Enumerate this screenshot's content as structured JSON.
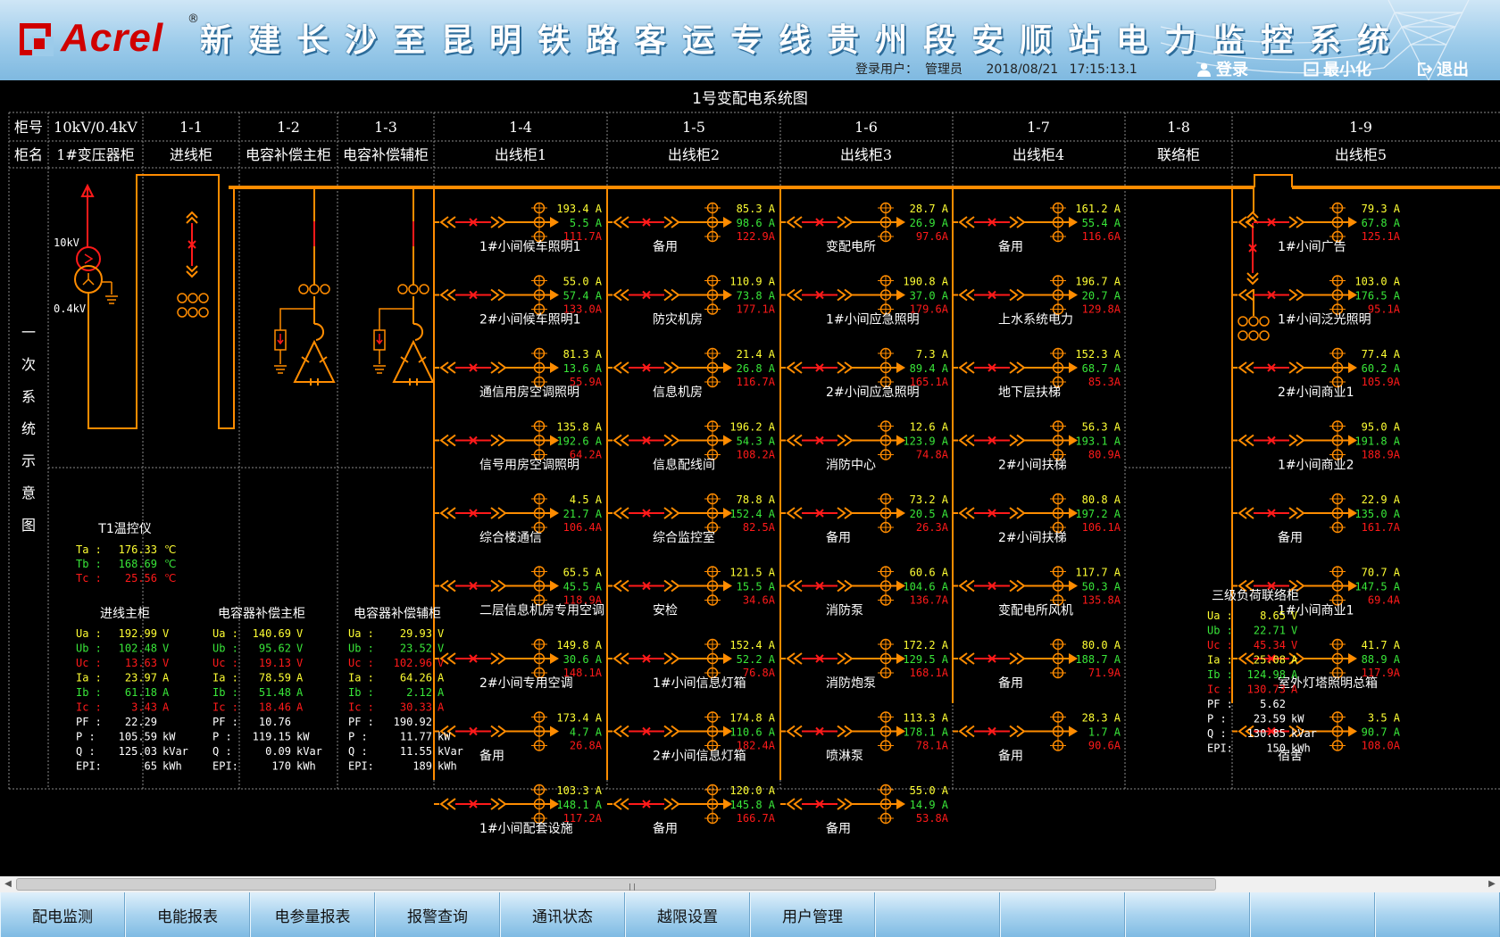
{
  "header": {
    "logo": "Acrel",
    "logo_reg": "®",
    "title": "新建长沙至昆明铁路客运专线贵州段安顺站电力监控系统",
    "login_label": "登录用户：",
    "user": "管理员",
    "date": "2018/08/21",
    "time": "17:15:13.1",
    "btn_login": "登录",
    "btn_minimize": "最小化",
    "btn_exit": "退出"
  },
  "page_title": "1号变配电系统图",
  "row_labels": {
    "cab_no": "柜号",
    "cab_name": "柜名",
    "side": [
      "一",
      "次",
      "系",
      "统",
      "示",
      "意",
      "图"
    ]
  },
  "columns": [
    {
      "no": "10kV/0.4kV",
      "name": "1#变压器柜"
    },
    {
      "no": "1-1",
      "name": "进线柜"
    },
    {
      "no": "1-2",
      "name": "电容补偿主柜"
    },
    {
      "no": "1-3",
      "name": "电容补偿辅柜"
    },
    {
      "no": "1-4",
      "name": "出线柜1"
    },
    {
      "no": "1-5",
      "name": "出线柜2"
    },
    {
      "no": "1-6",
      "name": "出线柜3"
    },
    {
      "no": "1-7",
      "name": "出线柜4"
    },
    {
      "no": "1-8",
      "name": "联络柜"
    },
    {
      "no": "1-9",
      "name": "出线柜5"
    }
  ],
  "transformer": {
    "hv": "10kV",
    "lv": "0.4kV"
  },
  "temp": {
    "title": "T1温控仪",
    "rows": [
      {
        "k": "Ta :",
        "v": "176.33",
        "u": "℃"
      },
      {
        "k": "Tb :",
        "v": "168.69",
        "u": "℃"
      },
      {
        "k": "Tc :",
        "v": "25.56",
        "u": "℃"
      }
    ]
  },
  "meters": [
    {
      "title": "进线主柜",
      "rows": [
        {
          "k": "Ua :",
          "v": "192.99",
          "u": "V"
        },
        {
          "k": "Ub :",
          "v": "102.48",
          "u": "V"
        },
        {
          "k": "Uc :",
          "v": "13.63",
          "u": "V"
        },
        {
          "k": "Ia :",
          "v": "23.97",
          "u": "A"
        },
        {
          "k": "Ib :",
          "v": "61.18",
          "u": "A"
        },
        {
          "k": "Ic :",
          "v": "3.43",
          "u": "A"
        },
        {
          "k": "PF :",
          "v": "22.29",
          "u": ""
        },
        {
          "k": "P  :",
          "v": "105.59",
          "u": "kW"
        },
        {
          "k": "Q  :",
          "v": "125.03",
          "u": "kVar"
        },
        {
          "k": "EPI:",
          "v": "65",
          "u": "kWh"
        }
      ]
    },
    {
      "title": "电容器补偿主柜",
      "rows": [
        {
          "k": "Ua :",
          "v": "140.69",
          "u": "V"
        },
        {
          "k": "Ub :",
          "v": "95.62",
          "u": "V"
        },
        {
          "k": "Uc :",
          "v": "19.13",
          "u": "V"
        },
        {
          "k": "Ia :",
          "v": "78.59",
          "u": "A"
        },
        {
          "k": "Ib :",
          "v": "51.48",
          "u": "A"
        },
        {
          "k": "Ic :",
          "v": "18.46",
          "u": "A"
        },
        {
          "k": "PF :",
          "v": "10.76",
          "u": ""
        },
        {
          "k": "P  :",
          "v": "119.15",
          "u": "kW"
        },
        {
          "k": "Q  :",
          "v": "0.09",
          "u": "kVar"
        },
        {
          "k": "EPI:",
          "v": "170",
          "u": "kWh"
        }
      ]
    },
    {
      "title": "电容器补偿辅柜",
      "rows": [
        {
          "k": "Ua :",
          "v": "29.93",
          "u": "V"
        },
        {
          "k": "Ub :",
          "v": "23.52",
          "u": "V"
        },
        {
          "k": "Uc :",
          "v": "102.96",
          "u": "V"
        },
        {
          "k": "Ia :",
          "v": "64.26",
          "u": "A"
        },
        {
          "k": "Ib :",
          "v": "2.12",
          "u": "A"
        },
        {
          "k": "Ic :",
          "v": "30.33",
          "u": "A"
        },
        {
          "k": "PF :",
          "v": "190.92",
          "u": ""
        },
        {
          "k": "P  :",
          "v": "11.77",
          "u": "kW"
        },
        {
          "k": "Q  :",
          "v": "11.55",
          "u": "kVar"
        },
        {
          "k": "EPI:",
          "v": "189",
          "u": "kWh"
        }
      ]
    },
    {
      "title": "三级负荷联络柜",
      "rows": [
        {
          "k": "Ua :",
          "v": "8.65",
          "u": "V"
        },
        {
          "k": "Ub :",
          "v": "22.71",
          "u": "V"
        },
        {
          "k": "Uc :",
          "v": "45.34",
          "u": "V"
        },
        {
          "k": "Ia :",
          "v": "25.08",
          "u": "A"
        },
        {
          "k": "Ib :",
          "v": "124.98",
          "u": "A"
        },
        {
          "k": "Ic :",
          "v": "130.73",
          "u": "A"
        },
        {
          "k": "PF :",
          "v": "5.62",
          "u": ""
        },
        {
          "k": "P  :",
          "v": "23.59",
          "u": "kW"
        },
        {
          "k": "Q  :",
          "v": "130.85",
          "u": "kVar"
        },
        {
          "k": "EPI:",
          "v": "150",
          "u": "kWh"
        }
      ]
    }
  ],
  "feeders": [
    [
      {
        "name": "1#小间候车照明1",
        "a": "193.4",
        "b": "5.5",
        "c": "111.7"
      },
      {
        "name": "2#小间候车照明1",
        "a": "55.0",
        "b": "57.4",
        "c": "133.0"
      },
      {
        "name": "通信用房空调照明",
        "a": "81.3",
        "b": "13.6",
        "c": "55.9"
      },
      {
        "name": "信号用房空调照明",
        "a": "135.8",
        "b": "192.6",
        "c": "64.2"
      },
      {
        "name": "综合楼通信",
        "a": "4.5",
        "b": "21.7",
        "c": "106.4"
      },
      {
        "name": "二层信息机房专用空调",
        "a": "65.5",
        "b": "45.5",
        "c": "118.9"
      },
      {
        "name": "2#小间专用空调",
        "a": "149.8",
        "b": "30.6",
        "c": "148.1"
      },
      {
        "name": "备用",
        "a": "173.4",
        "b": "4.7",
        "c": "26.8"
      },
      {
        "name": "1#小间配套设施",
        "a": "103.3",
        "b": "148.1",
        "c": "117.2"
      }
    ],
    [
      {
        "name": "备用",
        "a": "85.3",
        "b": "98.6",
        "c": "122.9"
      },
      {
        "name": "防灾机房",
        "a": "110.9",
        "b": "73.8",
        "c": "177.1"
      },
      {
        "name": "信息机房",
        "a": "21.4",
        "b": "26.8",
        "c": "116.7"
      },
      {
        "name": "信息配线间",
        "a": "196.2",
        "b": "54.3",
        "c": "108.2"
      },
      {
        "name": "综合监控室",
        "a": "78.8",
        "b": "152.4",
        "c": "82.5"
      },
      {
        "name": "安检",
        "a": "121.5",
        "b": "15.5",
        "c": "34.6"
      },
      {
        "name": "1#小间信息灯箱",
        "a": "152.4",
        "b": "52.2",
        "c": "76.8"
      },
      {
        "name": "2#小间信息灯箱",
        "a": "174.8",
        "b": "110.6",
        "c": "182.4"
      },
      {
        "name": "备用",
        "a": "120.0",
        "b": "145.8",
        "c": "166.7"
      }
    ],
    [
      {
        "name": "变配电所",
        "a": "28.7",
        "b": "26.9",
        "c": "97.6"
      },
      {
        "name": "1#小间应急照明",
        "a": "190.8",
        "b": "37.0",
        "c": "179.6"
      },
      {
        "name": "2#小间应急照明",
        "a": "7.3",
        "b": "89.4",
        "c": "165.1"
      },
      {
        "name": "消防中心",
        "a": "12.6",
        "b": "123.9",
        "c": "74.8"
      },
      {
        "name": "备用",
        "a": "73.2",
        "b": "20.5",
        "c": "26.3"
      },
      {
        "name": "消防泵",
        "a": "60.6",
        "b": "104.6",
        "c": "136.7"
      },
      {
        "name": "消防炮泵",
        "a": "172.2",
        "b": "129.5",
        "c": "168.1"
      },
      {
        "name": "喷淋泵",
        "a": "113.3",
        "b": "178.1",
        "c": "78.1"
      },
      {
        "name": "备用",
        "a": "55.0",
        "b": "14.9",
        "c": "53.8"
      }
    ],
    [
      {
        "name": "备用",
        "a": "161.2",
        "b": "55.4",
        "c": "116.6"
      },
      {
        "name": "上水系统电力",
        "a": "196.7",
        "b": "20.7",
        "c": "129.8"
      },
      {
        "name": "地下层扶梯",
        "a": "152.3",
        "b": "68.7",
        "c": "85.3"
      },
      {
        "name": "2#小间扶梯",
        "a": "56.3",
        "b": "193.1",
        "c": "80.9"
      },
      {
        "name": "2#小间扶梯",
        "a": "80.8",
        "b": "197.2",
        "c": "106.1"
      },
      {
        "name": "变配电所风机",
        "a": "117.7",
        "b": "50.3",
        "c": "135.8"
      },
      {
        "name": "备用",
        "a": "80.0",
        "b": "188.7",
        "c": "71.9"
      },
      {
        "name": "备用",
        "a": "28.3",
        "b": "1.7",
        "c": "90.6"
      }
    ],
    [
      {
        "name": "1#小间广告",
        "a": "79.3",
        "b": "67.8",
        "c": "125.1"
      },
      {
        "name": "1#小间泛光照明",
        "a": "103.0",
        "b": "176.5",
        "c": "95.1"
      },
      {
        "name": "2#小间商业1",
        "a": "77.4",
        "b": "60.2",
        "c": "105.9"
      },
      {
        "name": "1#小间商业2",
        "a": "95.0",
        "b": "191.8",
        "c": "188.9"
      },
      {
        "name": "备用",
        "a": "22.9",
        "b": "135.0",
        "c": "161.7"
      },
      {
        "name": "1#小间商业1",
        "a": "70.7",
        "b": "147.5",
        "c": "69.4"
      },
      {
        "name": "室外灯塔照明总箱",
        "a": "41.7",
        "b": "88.9",
        "c": "117.9"
      },
      {
        "name": "宿舍",
        "a": "3.5",
        "b": "90.7",
        "c": "108.0"
      }
    ]
  ],
  "unit_A": "A",
  "nav": [
    "配电监测",
    "电能报表",
    "电参量报表",
    "报警查询",
    "通讯状态",
    "越限设置",
    "用户管理",
    "",
    "",
    "",
    "",
    ""
  ],
  "colors": {
    "bus": "#ff8c00",
    "red": "#ff1a1a",
    "green": "#39e639",
    "yellow": "#ffff33",
    "grid": "#8a8a8a"
  }
}
